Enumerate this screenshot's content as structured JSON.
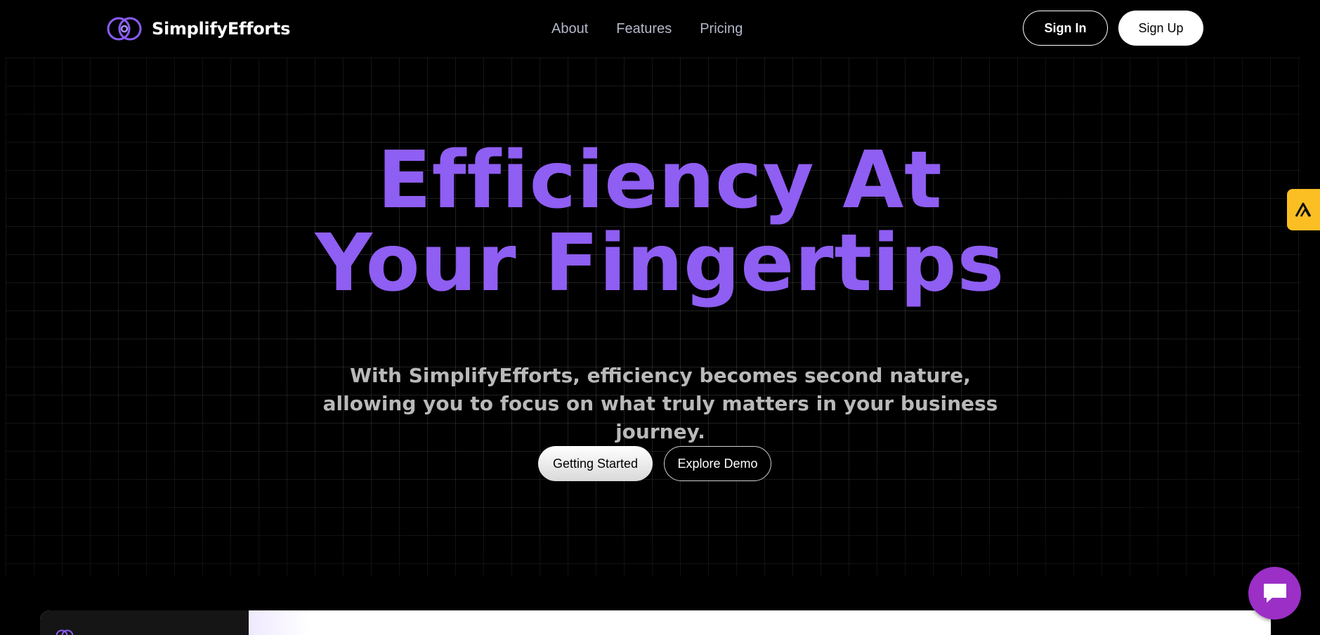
{
  "brand": {
    "name": "SimplifyEfforts",
    "logo_icon": "brand-logo-icon",
    "accent_color": "#8b5cf6"
  },
  "nav": {
    "items": [
      {
        "label": "About"
      },
      {
        "label": "Features"
      },
      {
        "label": "Pricing"
      }
    ]
  },
  "auth": {
    "sign_in_label": "Sign In",
    "sign_up_label": "Sign Up"
  },
  "hero": {
    "title_line1": "Efficiency At",
    "title_line2": "Your Fingertips",
    "subtitle": "With SimplifyEfforts, efficiency becomes second nature, allowing you to focus on what truly matters in your business journey.",
    "title_color": "#8f5ef2",
    "primary_cta": "Getting Started",
    "secondary_cta": "Explore Demo"
  },
  "widgets": {
    "side_tab_icon": "triangle-logo-icon",
    "side_tab_color": "#fbbf24",
    "chat_icon": "chat-icon",
    "chat_color": "#9b2fc6"
  }
}
